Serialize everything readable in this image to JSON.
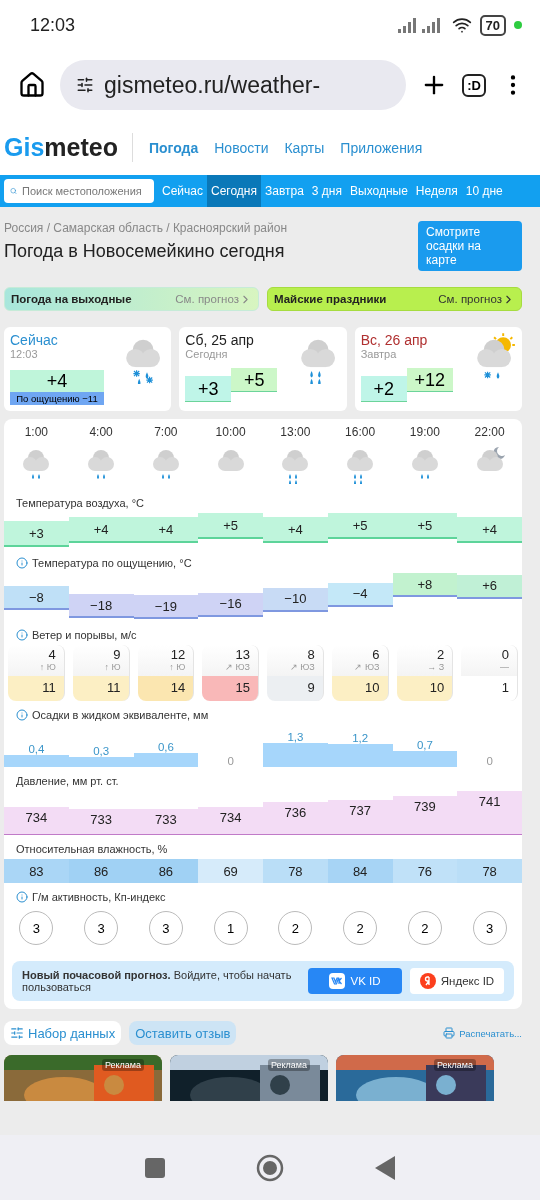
{
  "status_bar": {
    "time": "12:03",
    "battery": "70"
  },
  "browser": {
    "url": "gismeteo.ru/weather-",
    "tabs_label": ":D"
  },
  "site_header": {
    "logo": {
      "accent": "Gis",
      "rest": "meteo"
    },
    "links": [
      {
        "label": "Погода",
        "selected": true
      },
      {
        "label": "Новости",
        "selected": false
      },
      {
        "label": "Карты",
        "selected": false
      },
      {
        "label": "Приложения",
        "selected": false
      }
    ]
  },
  "search": {
    "placeholder": "Поиск местоположения"
  },
  "period_tabs": [
    {
      "label": "Сейчас",
      "selected": false
    },
    {
      "label": "Сегодня",
      "selected": true
    },
    {
      "label": "Завтра",
      "selected": false
    },
    {
      "label": "3 дня",
      "selected": false
    },
    {
      "label": "Выходные",
      "selected": false
    },
    {
      "label": "Неделя",
      "selected": false
    },
    {
      "label": "10 дне",
      "selected": false
    }
  ],
  "breadcrumb": "Россия / Самарская область / Красноярский район",
  "title": "Погода в Новосемейкино сегодня",
  "map_button": "Смотрите осадки на карте",
  "promos": [
    {
      "title": "Погода на выходные",
      "link": "См. прогноз",
      "kind": "green"
    },
    {
      "title": "Майские праздники",
      "link": "См. прогноз",
      "kind": "lime"
    }
  ],
  "now_card": {
    "title": "Сейчас",
    "time": "12:03",
    "temp": "+4",
    "feels": "По ощущению −11",
    "kind": "rain-snow"
  },
  "day_cards": [
    {
      "date": "Сб, 25 апр",
      "label": "Сегодня",
      "weekend": false,
      "min": "+3",
      "max": "+5",
      "kind": "rain"
    },
    {
      "date": "Вс, 26 апр",
      "label": "Завтра",
      "weekend": true,
      "min": "+2",
      "max": "+12",
      "kind": "sun-snow-rain"
    }
  ],
  "hourly": {
    "hours": [
      {
        "time": "1:00",
        "kind": "light-rain"
      },
      {
        "time": "4:00",
        "kind": "light-rain"
      },
      {
        "time": "7:00",
        "kind": "light-rain"
      },
      {
        "time": "10:00",
        "kind": "cloudy"
      },
      {
        "time": "13:00",
        "kind": "rain"
      },
      {
        "time": "16:00",
        "kind": "rain"
      },
      {
        "time": "19:00",
        "kind": "light-rain"
      },
      {
        "time": "22:00",
        "kind": "night-cloudy"
      }
    ],
    "temperature": {
      "title": "Температура воздуха, °C",
      "values": [
        "+3",
        "+4",
        "+4",
        "+5",
        "+4",
        "+5",
        "+5",
        "+4"
      ]
    },
    "feels_like": {
      "title": "Температура по ощущению, °C",
      "cells": [
        {
          "value": "−8",
          "color": "#bfe0f7"
        },
        {
          "value": "−18",
          "color": "#cfd3f5"
        },
        {
          "value": "−19",
          "color": "#cfd3f5"
        },
        {
          "value": "−16",
          "color": "#cfd3f5"
        },
        {
          "value": "−10",
          "color": "#c8dbf5"
        },
        {
          "value": "−4",
          "color": "#c4e8f8"
        },
        {
          "value": "+8",
          "color": "#c2f2cf"
        },
        {
          "value": "+6",
          "color": "#c0f0d6"
        }
      ]
    },
    "wind": {
      "title": "Ветер и порывы, м/с",
      "cells": [
        {
          "speed": "4",
          "direction": "↑ Ю",
          "gust": "11",
          "color": "#fcefc4"
        },
        {
          "speed": "9",
          "direction": "↑ Ю",
          "gust": "11",
          "color": "#fcefc4"
        },
        {
          "speed": "12",
          "direction": "↑ Ю",
          "gust": "14",
          "color": "#fbe6b0"
        },
        {
          "speed": "13",
          "direction": "↗ ЮЗ",
          "gust": "15",
          "color": "#f9b8b8"
        },
        {
          "speed": "8",
          "direction": "↗ ЮЗ",
          "gust": "9",
          "color": "#eceff2"
        },
        {
          "speed": "6",
          "direction": "↗ ЮЗ",
          "gust": "10",
          "color": "#fcefc4"
        },
        {
          "speed": "2",
          "direction": "→ З",
          "gust": "10",
          "color": "#fcefc4"
        },
        {
          "speed": "0",
          "direction": "—",
          "gust": "1",
          "color": "#ffffff"
        }
      ]
    },
    "precipitation": {
      "title": "Осадки в жидком эквиваленте, мм",
      "values": [
        "0,4",
        "0,3",
        "0,6",
        "0",
        "1,3",
        "1,2",
        "0,7",
        "0"
      ]
    },
    "pressure": {
      "title": "Давление, мм рт. ст.",
      "values": [
        "734",
        "733",
        "733",
        "734",
        "736",
        "737",
        "739",
        "741"
      ]
    },
    "humidity": {
      "title": "Относительная влажность, %",
      "values": [
        "83",
        "86",
        "86",
        "69",
        "78",
        "84",
        "76",
        "78"
      ]
    },
    "geomagnetic": {
      "title": "Г/м активность, Кп-индекс",
      "values": [
        "3",
        "3",
        "3",
        "1",
        "2",
        "2",
        "2",
        "3"
      ]
    }
  },
  "login_banner": {
    "text": "**Новый почасовой прогноз.** Войдите, чтобы начать пользоваться",
    "buttons": [
      {
        "label": "VK ID",
        "kind": "vk"
      },
      {
        "label": "Яндекс ID",
        "kind": "yandex"
      }
    ]
  },
  "toolbar": {
    "dataset": "Набор данных",
    "feedback": "Оставить отзыв",
    "print": "Распечатать..."
  },
  "ads": [
    {
      "label": "Реклама",
      "kind": "picture"
    },
    {
      "label": "Реклама",
      "kind": "picture"
    },
    {
      "label": "Реклама",
      "kind": "picture"
    }
  ]
}
